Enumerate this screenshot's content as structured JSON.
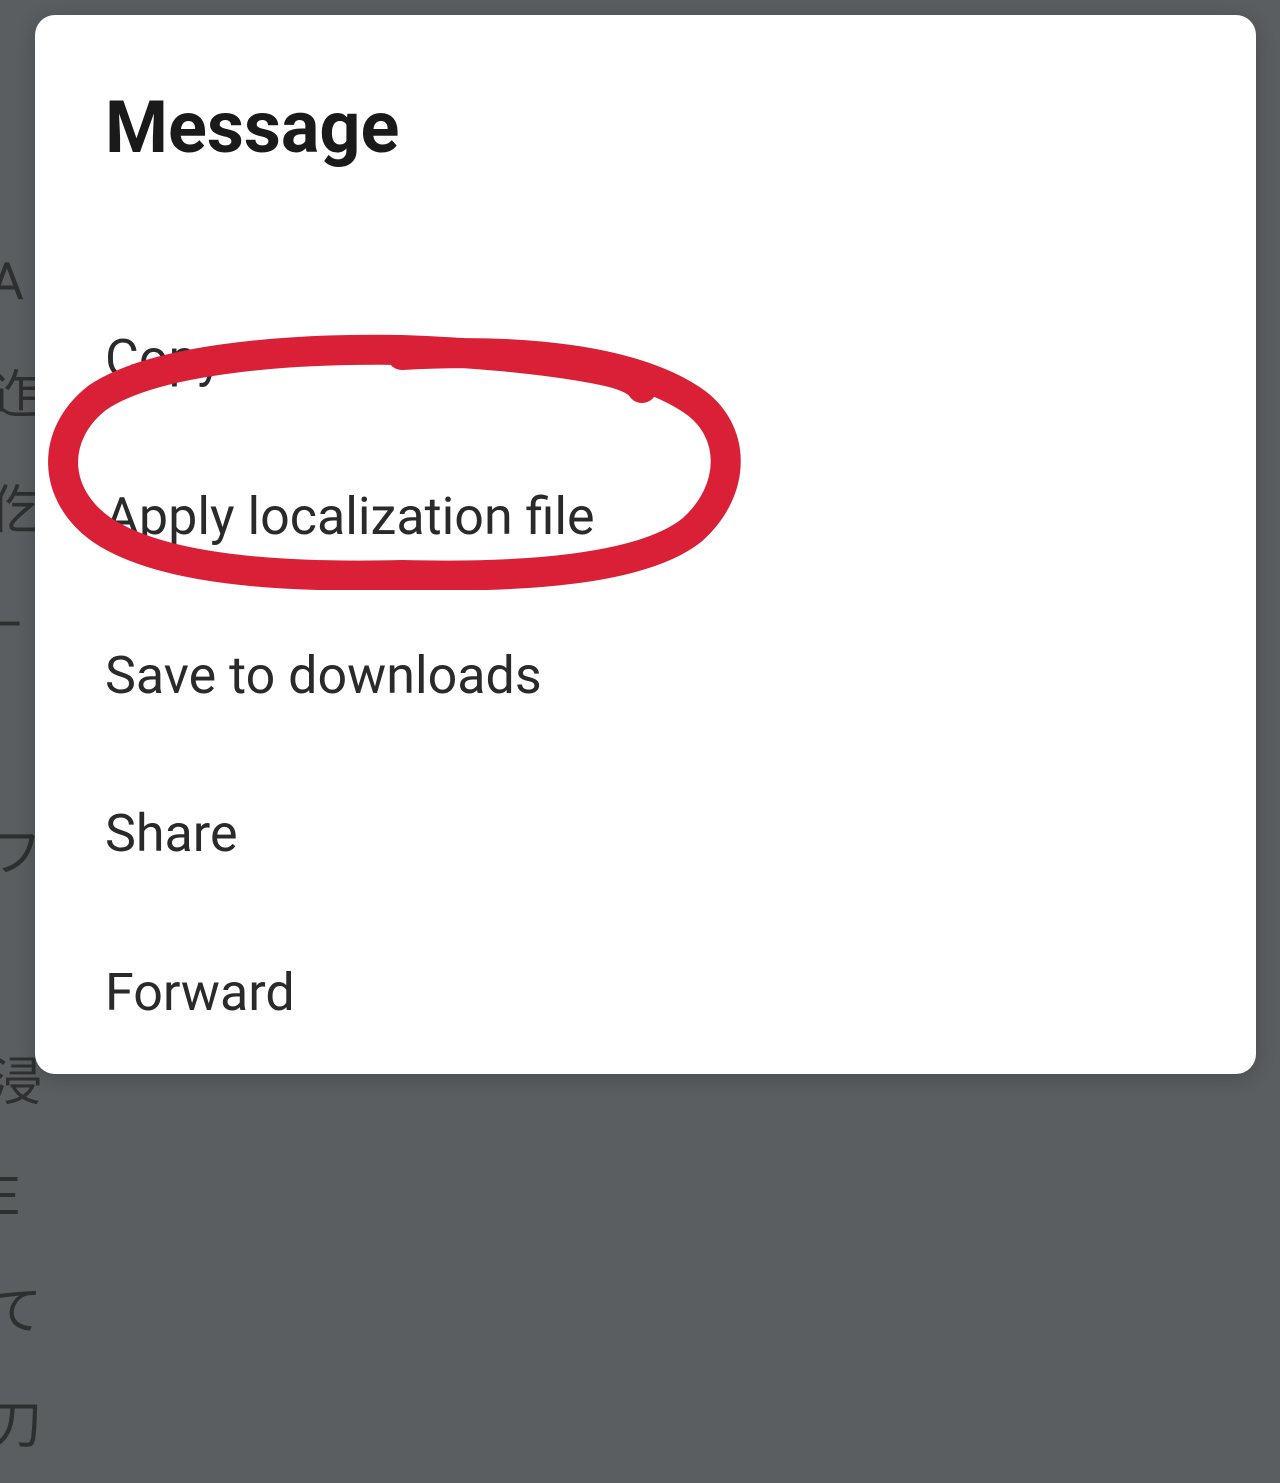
{
  "dialog": {
    "title": "Message",
    "items": [
      "Copy",
      "Apply localization file",
      "Save to downloads",
      "Share",
      "Forward"
    ]
  },
  "annotation": {
    "color": "#d92037",
    "highlighted_item_index": 1
  },
  "background": {
    "text_fragments": "A\n迮\n仡\n–\nI\nフ\n\n浸\nE\nて\n刀"
  }
}
